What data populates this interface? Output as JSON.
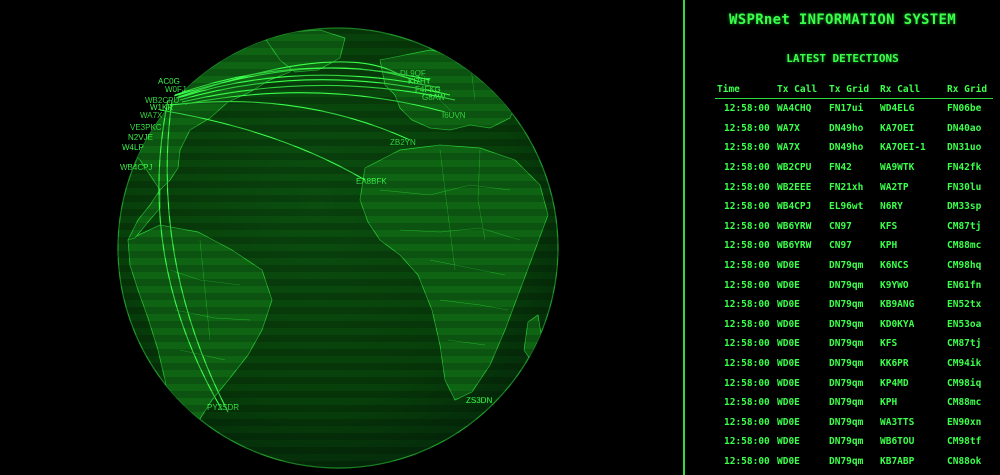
{
  "header": {
    "system_title": "WSPRnet INFORMATION SYSTEM",
    "section_title": "LATEST DETECTIONS"
  },
  "table": {
    "columns": [
      "Time",
      "Tx Call",
      "Tx Grid",
      "Rx Call",
      "Rx Grid"
    ],
    "rows": [
      [
        "12:58:00",
        "WA4CHQ",
        "FN17ui",
        "WD4ELG",
        "FN06be"
      ],
      [
        "12:58:00",
        "WA7X",
        "DN49ho",
        "KA7OEI",
        "DN40ao"
      ],
      [
        "12:58:00",
        "WA7X",
        "DN49ho",
        "KA7OEI-1",
        "DN31uo"
      ],
      [
        "12:58:00",
        "WB2CPU",
        "FN42",
        "WA9WTK",
        "FN42fk"
      ],
      [
        "12:58:00",
        "WB2EEE",
        "FN21xh",
        "WA2TP",
        "FN30lu"
      ],
      [
        "12:58:00",
        "WB4CPJ",
        "EL96wt",
        "N6RY",
        "DM33sp"
      ],
      [
        "12:58:00",
        "WB6YRW",
        "CN97",
        "KFS",
        "CM87tj"
      ],
      [
        "12:58:00",
        "WB6YRW",
        "CN97",
        "KPH",
        "CM88mc"
      ],
      [
        "12:58:00",
        "WD0E",
        "DN79qm",
        "K6NCS",
        "CM98hq"
      ],
      [
        "12:58:00",
        "WD0E",
        "DN79qm",
        "K9YWO",
        "EN61fn"
      ],
      [
        "12:58:00",
        "WD0E",
        "DN79qm",
        "KB9ANG",
        "EN52tx"
      ],
      [
        "12:58:00",
        "WD0E",
        "DN79qm",
        "KD0KYA",
        "EN53oa"
      ],
      [
        "12:58:00",
        "WD0E",
        "DN79qm",
        "KFS",
        "CM87tj"
      ],
      [
        "12:58:00",
        "WD0E",
        "DN79qm",
        "KK6PR",
        "CM94ik"
      ],
      [
        "12:58:00",
        "WD0E",
        "DN79qm",
        "KP4MD",
        "CM98iq"
      ],
      [
        "12:58:00",
        "WD0E",
        "DN79qm",
        "KPH",
        "CM88mc"
      ],
      [
        "12:58:00",
        "WD0E",
        "DN79qm",
        "WA3TTS",
        "EN90xn"
      ],
      [
        "12:58:00",
        "WD0E",
        "DN79qm",
        "WB6TOU",
        "CM98tf"
      ],
      [
        "12:58:00",
        "WD0E",
        "DN79qm",
        "KB7ABP",
        "CN88ok"
      ]
    ]
  },
  "globe": {
    "station_labels": [
      "WB4CPJ",
      "ZB2YN",
      "EA8BFK",
      "PY2SDR",
      "ZS3DN",
      "I6UVN",
      "WA7X",
      "AC0G",
      "WB2CPU",
      "DL9QF",
      "F4FKG",
      "G8AW",
      "VE3PKC",
      "N2VJE",
      "W4LP",
      "W1KR",
      "W0FJ",
      "KI7HT"
    ],
    "accent_color": "#33ff44",
    "land_color": "#0d5a12",
    "ocean_color": "#073d0a"
  }
}
